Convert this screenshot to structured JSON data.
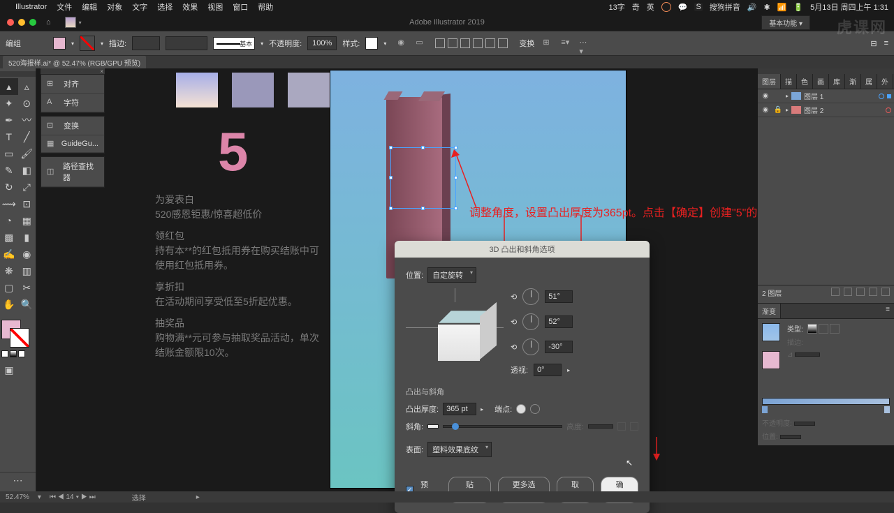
{
  "menubar": {
    "app": "Illustrator",
    "items": [
      "文件",
      "编辑",
      "对象",
      "文字",
      "选择",
      "效果",
      "视图",
      "窗口",
      "帮助"
    ],
    "status_right": [
      "13字",
      "奇",
      "英"
    ],
    "sogou": "搜狗拼音",
    "date": "5月13日 周四上午 1:31"
  },
  "window": {
    "title": "Adobe Illustrator 2019",
    "workspace": "基本功能"
  },
  "controlbar": {
    "mode": "编组",
    "stroke_label": "描边:",
    "stroke_val": "",
    "line_label": "基本",
    "opacity_label": "不透明度:",
    "opacity": "100%",
    "style_label": "样式:",
    "transform_label": "变换"
  },
  "doc_tab": "520海报样.ai* @ 52.47% (RGB/GPU 预览)",
  "float_panel": {
    "items": [
      "对齐",
      "字符",
      "变换",
      "GuideGu...",
      "路径查找器"
    ]
  },
  "page_text": {
    "h1": "为爱表白",
    "p1": "520感恩钜惠/惊喜超低价",
    "h2": "领红包",
    "p2": "持有本**的红包抵用券在购买结账中可使用红包抵用券。",
    "h3": "享折扣",
    "p3": "在活动期间享受低至5折起优惠。",
    "h4": "抽奖品",
    "p4": "购物满**元可参与抽取奖品活动，单次结账金额限10次。"
  },
  "annotation": "调整角度，设置凸出厚度为365pt。点击【确定】创建\"5\"的立体效果",
  "dialog": {
    "title": "3D 凸出和斜角选项",
    "position_label": "位置:",
    "position_val": "自定旋转",
    "rot_x": "51°",
    "rot_y": "52°",
    "rot_z": "-30°",
    "persp_label": "透视:",
    "persp_val": "0°",
    "section": "凸出与斜角",
    "depth_label": "凸出厚度:",
    "depth_val": "365 pt",
    "cap_label": "端点:",
    "bevel_label": "斜角:",
    "height_label": "高度:",
    "surface_label": "表面:",
    "surface_val": "塑料效果底纹",
    "preview": "预览",
    "map": "贴图...",
    "more": "更多选项",
    "cancel": "取消",
    "ok": "确定"
  },
  "layers": {
    "tabs": [
      "图层",
      "描",
      "色",
      "画",
      "库",
      "渐",
      "属",
      "外"
    ],
    "items": [
      {
        "name": "图层 1",
        "color": "#4aa3ff"
      },
      {
        "name": "图层 2",
        "color": "#e85a5a"
      }
    ],
    "footer": "2 图层",
    "gradient_tab": "渐变",
    "type_label": "类型:",
    "stroke_label": "描边:",
    "opacity_label": "不透明度:",
    "pos_label": "位置:"
  },
  "status": {
    "zoom": "52.47%",
    "nav": "14",
    "sel": "选择"
  },
  "watermark": "虎课网"
}
